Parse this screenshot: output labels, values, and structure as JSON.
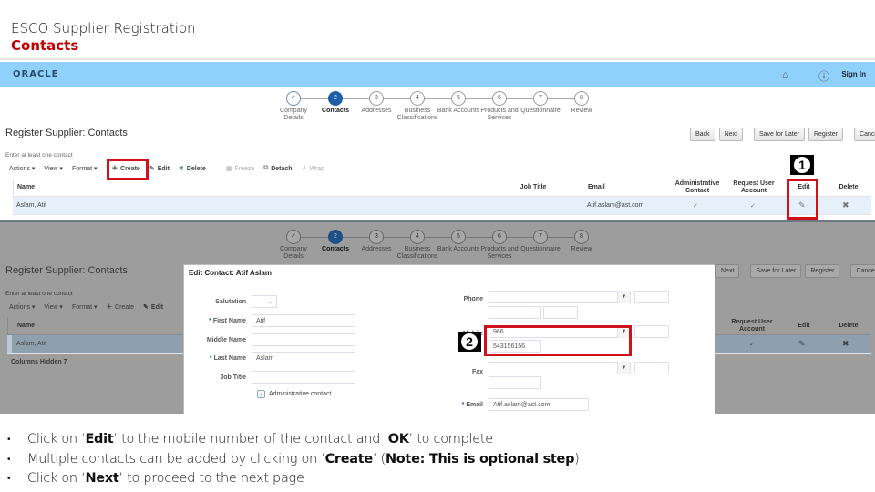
{
  "slide": {
    "title": "ESCO Supplier Registration",
    "subtitle": "Contacts"
  },
  "header": {
    "logo": "ORACLE",
    "home_icon": "home-icon",
    "info_icon": "info-icon",
    "sign_in": "Sign In"
  },
  "train": {
    "steps": [
      {
        "num": "✓",
        "label": "Company Details",
        "state": "done"
      },
      {
        "num": "2",
        "label": "Contacts",
        "state": "active"
      },
      {
        "num": "3",
        "label": "Addresses",
        "state": "todo"
      },
      {
        "num": "4",
        "label": "Business Classifications",
        "state": "todo"
      },
      {
        "num": "5",
        "label": "Bank Accounts",
        "state": "todo"
      },
      {
        "num": "6",
        "label": "Products and Services",
        "state": "todo"
      },
      {
        "num": "7",
        "label": "Questionnaire",
        "state": "todo"
      },
      {
        "num": "8",
        "label": "Review",
        "state": "todo"
      }
    ]
  },
  "page": {
    "heading": "Register Supplier: Contacts",
    "hint": "Enter at least one contact",
    "buttons": {
      "back": "Back",
      "next": "Next",
      "save_later": "Save for Later",
      "register": "Register",
      "cancel": "Cancel"
    },
    "toolbar": {
      "actions": "Actions ▾",
      "view": "View ▾",
      "format": "Format ▾",
      "create": "Create",
      "edit": "Edit",
      "delete": "Delete",
      "freeze": "Freeze",
      "detach": "Detach",
      "wrap": "Wrap"
    },
    "table": {
      "columns": {
        "name": "Name",
        "job_title": "Job Title",
        "email": "Email",
        "admin": "Administrative Contact",
        "request": "Request User Account",
        "edit": "Edit",
        "delete": "Delete"
      },
      "rows": [
        {
          "name": "Aslam, Atif",
          "job_title": "",
          "email": "Atif.aslam@ast.com",
          "admin": "✓",
          "request": "✓"
        }
      ],
      "columns_hidden": "Columns Hidden  7"
    }
  },
  "callouts": {
    "one": "1",
    "two": "2"
  },
  "dialog": {
    "title": "Edit Contact: Atif Aslam",
    "fields": {
      "salutation_label": "Salutation",
      "salutation_value": "",
      "first_name_label": "First Name",
      "first_name_value": "Atif",
      "middle_name_label": "Middle Name",
      "middle_name_value": "",
      "last_name_label": "Last Name",
      "last_name_value": "Aslam",
      "job_title_label": "Job Title",
      "job_title_value": "",
      "admin_contact_label": "Administrative contact",
      "admin_contact_checked": true,
      "phone_label": "Phone",
      "mobile_label": "Mobile",
      "mobile_country": "966",
      "mobile_number": "543156156",
      "fax_label": "Fax",
      "email_label": "Email",
      "email_value": "Atif.aslam@ast.com"
    }
  },
  "notes": {
    "n1_a": "Click on ‘",
    "n1_b": "Edit",
    "n1_c": "’  to the mobile number of the contact and ‘",
    "n1_d": "OK",
    "n1_e": "’ to complete",
    "n2_a": "Multiple contacts can be added by clicking on ‘",
    "n2_b": "Create",
    "n2_c": "’ (",
    "n2_d": "Note: This is optional step",
    "n2_e": ")",
    "n3_a": "Click on ‘",
    "n3_b": "Next",
    "n3_c": "’ to proceed to the next page"
  },
  "colors": {
    "accent_red": "#c00000",
    "header_blue": "#8fd1fb",
    "train_active": "#1e5fa8",
    "highlight_red": "#d0101a"
  }
}
